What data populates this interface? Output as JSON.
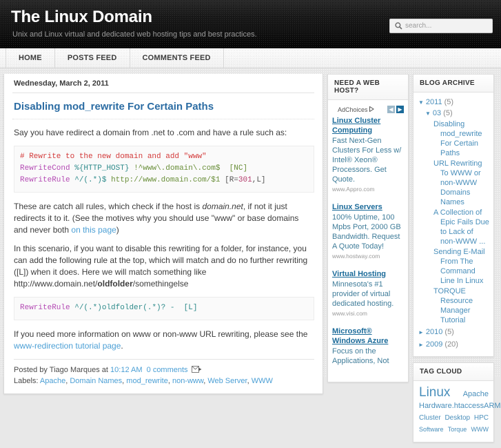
{
  "header": {
    "title": "The Linux Domain",
    "description": "Unix and Linux virtual and dedicated web hosting tips and best practices.",
    "search_placeholder": "search...",
    "search_value": ""
  },
  "nav": {
    "items": [
      {
        "label": "HOME"
      },
      {
        "label": "POSTS FEED"
      },
      {
        "label": "COMMENTS FEED"
      }
    ]
  },
  "post": {
    "date": "Wednesday, March 2, 2011",
    "title": "Disabling mod_rewrite For Certain Paths",
    "p1": "Say you have redirect a domain from .net to .com and have a rule such as:",
    "code1": {
      "line1": "# Rewrite to the new domain and add \"www\"",
      "line2_kw": "RewriteCond",
      "line2_var": "%{HTTP_HOST}",
      "line2_rest": "!^www\\.domain\\.com$  [NC]",
      "line3_kw": "RewriteRule",
      "line3_a": "^/(.*)$",
      "line3_b": "http://www.domain.com/$1",
      "line3_c": "[R=",
      "line3_num": "301",
      "line3_d": ",L]"
    },
    "p2_a": "These are catch all rules, which check if the host is ",
    "p2_i": "domain.net",
    "p2_b": ", if not it just redirects it to it. (See the motives why you should use \"www\" or base domains and never both ",
    "p2_link": "on this page",
    "p2_c": ")",
    "p3_a": "In this scenario, if you want to disable this rewriting for a folder, for instance, you can add the following rule at the top, which will match and do no further rewriting ([L]) when it does. Here we will match something like http://www.domain.net/",
    "p3_bold": "oldfolder",
    "p3_b": "/somethingelse",
    "code2": {
      "kw": "RewriteRule",
      "rest": "^/(.*)oldfolder(.*)? -  [L]"
    },
    "p4_a": "If you need more information on www or non-www URL rewriting, please see the ",
    "p4_link": "www-redirection tutorial page",
    "p4_b": ".",
    "footer": {
      "posted_by": "Posted by Tiago Marques at ",
      "time": "10:12 AM",
      "comments": "0 comments",
      "labels_label": "Labels: ",
      "labels": [
        "Apache",
        "Domain Names",
        "mod_rewrite",
        "non-www",
        "Web Server",
        "WWW"
      ]
    }
  },
  "ads": {
    "heading": "NEED A WEB HOST?",
    "adchoices_label": "AdChoices",
    "prev_arrow": "◀",
    "next_arrow": "▶",
    "items": [
      {
        "title": "Linux Cluster Computing",
        "text": "Fast Next-Gen Clusters For Less w/ Intel® Xeon® Processors. Get Quote.",
        "url": "www.Appro.com"
      },
      {
        "title": "Linux Servers",
        "text": "100% Uptime, 100 Mpbs Port, 2000 GB Bandwidth. Request A Quote Today!",
        "url": "www.hostway.com"
      },
      {
        "title": "Virtual Hosting",
        "text": "Minnesota's #1 provider of virtual dedicated hosting.",
        "url": "www.visi.com"
      },
      {
        "title": "Microsoft® Windows Azure",
        "text": "Focus on the Applications, Not",
        "url": ""
      }
    ]
  },
  "archive": {
    "heading": "BLOG ARCHIVE",
    "years": [
      {
        "expanded": true,
        "triangle": "▼",
        "label": "2011",
        "count": "(5)",
        "months": [
          {
            "expanded": true,
            "triangle": "▼",
            "label": "03",
            "count": "(5)",
            "posts": [
              "Disabling mod_rewrite For Certain Paths",
              "URL Rewriting To WWW or non-WWW Domains Names",
              "A Collection of Epic Fails Due to Lack of non-WWW ...",
              "Sending E-Mail From The Command Line In Linux",
              "TORQUE Resource Manager Tutorial"
            ]
          }
        ]
      },
      {
        "expanded": false,
        "triangle": "►",
        "label": "2010",
        "count": "(5)",
        "months": []
      },
      {
        "expanded": false,
        "triangle": "►",
        "label": "2009",
        "count": "(20)",
        "months": []
      }
    ]
  },
  "tagcloud": {
    "heading": "TAG CLOUD",
    "rows": [
      [
        {
          "label": "Linux",
          "size": "t-xl"
        },
        {
          "label": "Apache",
          "size": "t-m"
        }
      ],
      [
        {
          "label": "Hardware",
          "size": "t-m"
        },
        {
          "label": ".htaccess",
          "size": "t-m"
        },
        {
          "label": "ARM",
          "size": "t-m"
        }
      ],
      [
        {
          "label": "Cluster",
          "size": "t-s"
        },
        {
          "label": "Desktop",
          "size": "t-s"
        },
        {
          "label": "HPC",
          "size": "t-s"
        }
      ],
      [
        {
          "label": "Software",
          "size": "t-xs"
        },
        {
          "label": "Torque",
          "size": "t-xs"
        },
        {
          "label": "WWW",
          "size": "t-xs"
        }
      ]
    ]
  },
  "colors": {
    "header_bg": "#111111",
    "link": "#4b9fd5",
    "post_title": "#2b6ca3",
    "ad_link": "#1a6a99",
    "sidebar_link": "#4a8fbb"
  }
}
